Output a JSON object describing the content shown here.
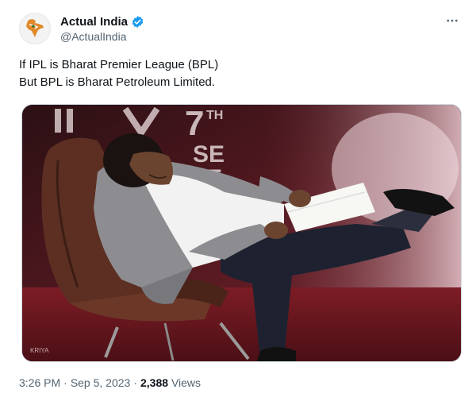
{
  "account": {
    "name": "Actual India",
    "handle": "@ActualIndia",
    "verified": true,
    "verified_color": "#1d9bf0"
  },
  "tweet": {
    "lines": [
      "If IPL is Bharat Premier League (BPL)",
      "But BPL is Bharat Petroleum Limited."
    ]
  },
  "media": {
    "banner_lines": [
      "7",
      "TH",
      "SE",
      "E"
    ],
    "watermark": "KRIYA"
  },
  "meta": {
    "time": "3:26 PM",
    "separator": "·",
    "date": "Sep 5, 2023",
    "views_count": "2,388",
    "views_label": "Views"
  },
  "icons": {
    "avatar": "india-map-logo",
    "verified": "verified-badge-icon",
    "more": "more-options-icon"
  },
  "colors": {
    "text": "#0f1419",
    "secondary": "#536471",
    "photo_background": "#3a1418"
  }
}
